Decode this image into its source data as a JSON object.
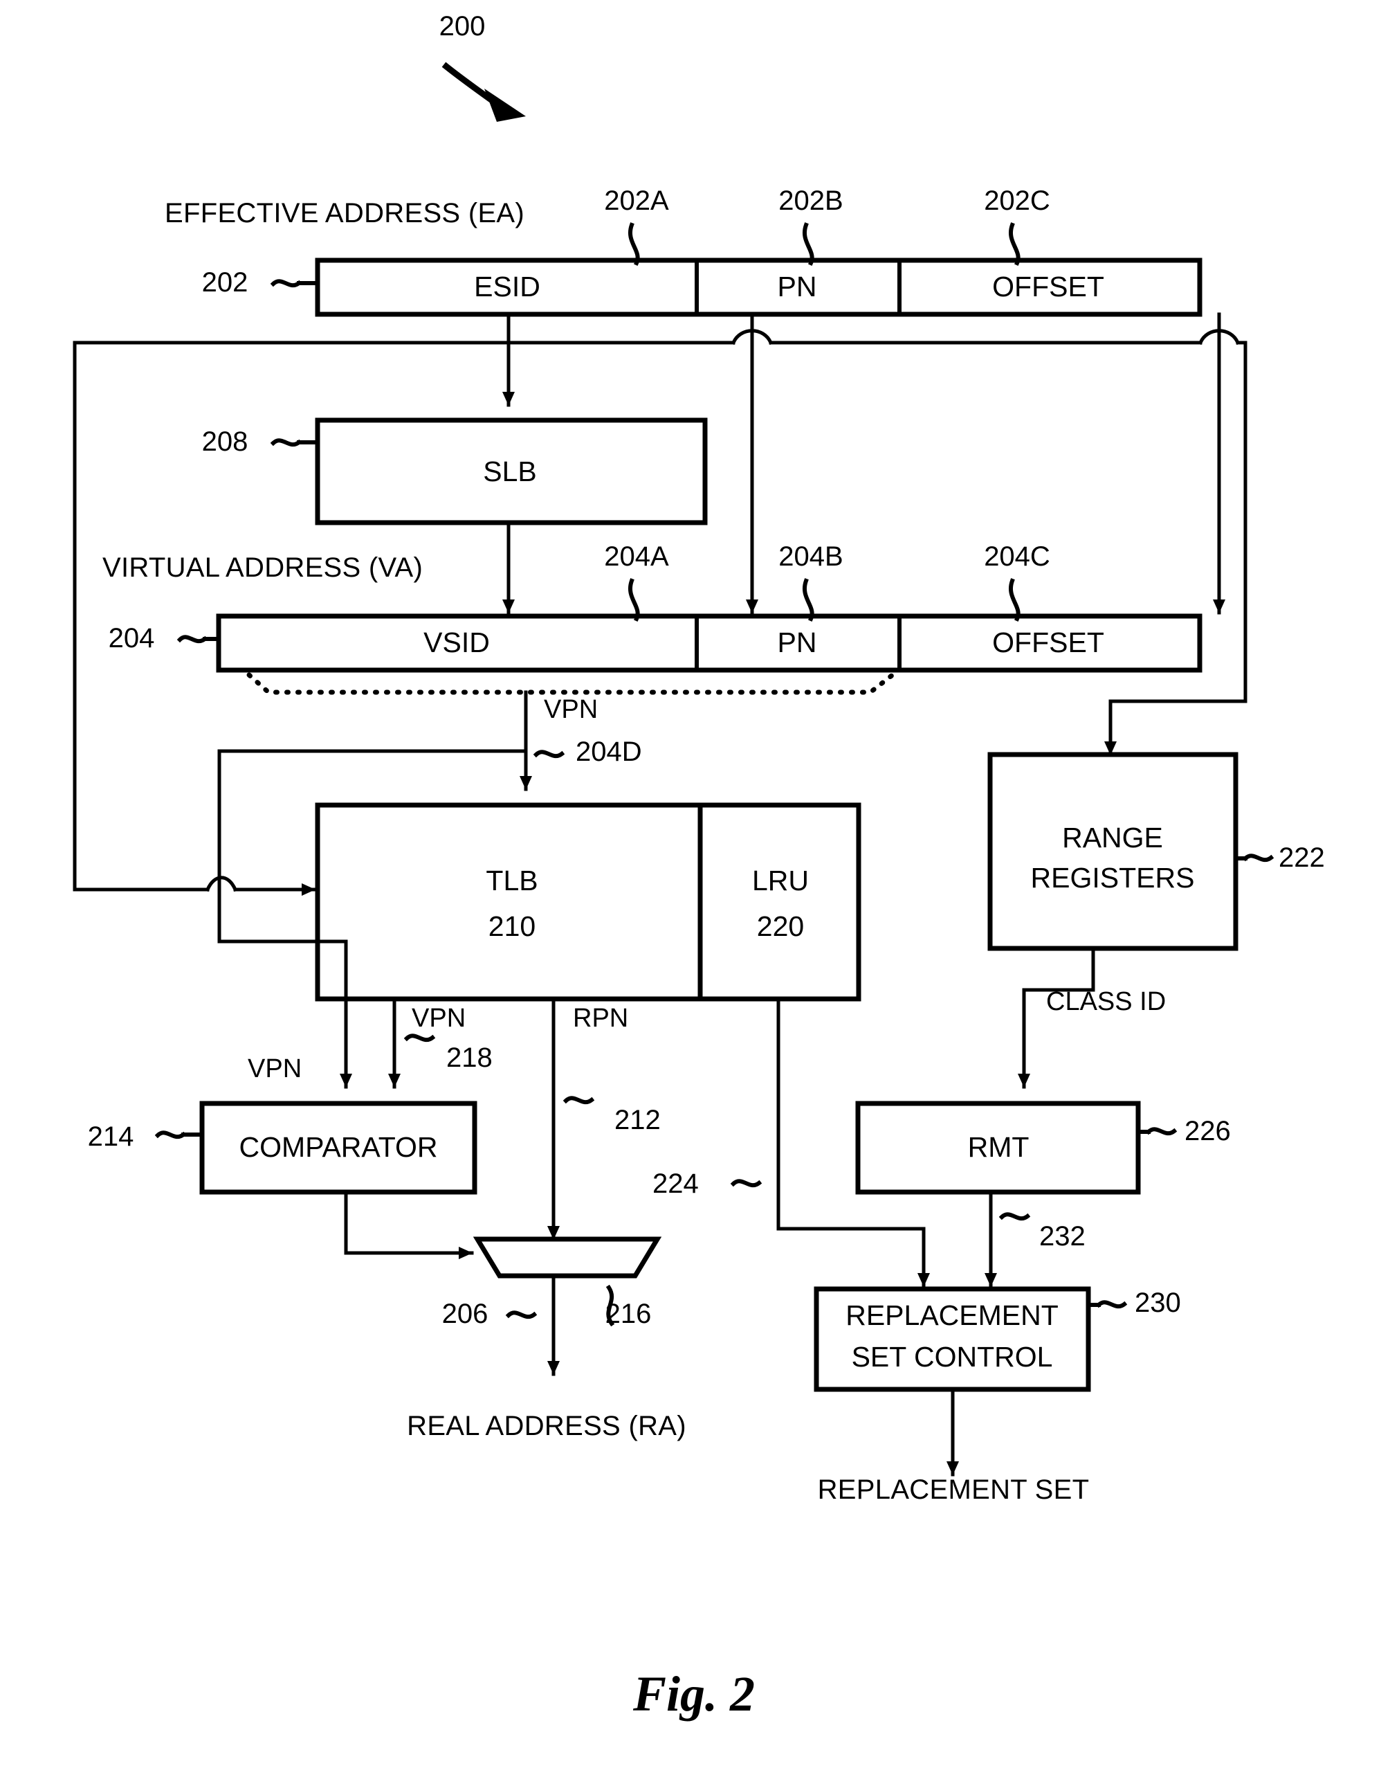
{
  "figure": {
    "caption": "Fig. 2",
    "system_ref": "200"
  },
  "effective_address": {
    "title": "EFFECTIVE ADDRESS (EA)",
    "ref": "202",
    "fields": [
      {
        "label": "ESID",
        "ref": "202A"
      },
      {
        "label": "PN",
        "ref": "202B"
      },
      {
        "label": "OFFSET",
        "ref": "202C"
      }
    ]
  },
  "virtual_address": {
    "title": "VIRTUAL ADDRESS (VA)",
    "ref": "204",
    "fields": [
      {
        "label": "VSID",
        "ref": "204A"
      },
      {
        "label": "PN",
        "ref": "204B"
      },
      {
        "label": "OFFSET",
        "ref": "204C"
      }
    ],
    "vpn_label": "VPN",
    "vpn_ref": "204D"
  },
  "blocks": {
    "slb": {
      "label": "SLB",
      "ref": "208"
    },
    "tlb": {
      "label": "TLB",
      "number": "210"
    },
    "lru": {
      "label": "LRU",
      "number": "220"
    },
    "range_registers": {
      "line1": "RANGE",
      "line2": "REGISTERS",
      "ref": "222"
    },
    "comparator": {
      "label": "COMPARATOR",
      "ref": "214"
    },
    "rmt": {
      "label": "RMT",
      "ref": "226"
    },
    "replacement_set_control": {
      "line1": "REPLACEMENT",
      "line2": "SET CONTROL",
      "ref": "230"
    },
    "mux": {
      "ref": "216"
    }
  },
  "signals": {
    "vpn_to_comparator": "VPN",
    "vpn_from_tlb": "VPN",
    "vpn_from_tlb_ref": "218",
    "rpn_from_tlb": "RPN",
    "rpn_ref": "212",
    "lru_out_ref": "224",
    "class_id": "CLASS ID",
    "rmt_out_ref": "232",
    "ra_ref": "206",
    "real_address": "REAL ADDRESS (RA)",
    "replacement_set": "REPLACEMENT SET"
  },
  "colors": {
    "ink": "#000000",
    "paper": "#ffffff"
  }
}
